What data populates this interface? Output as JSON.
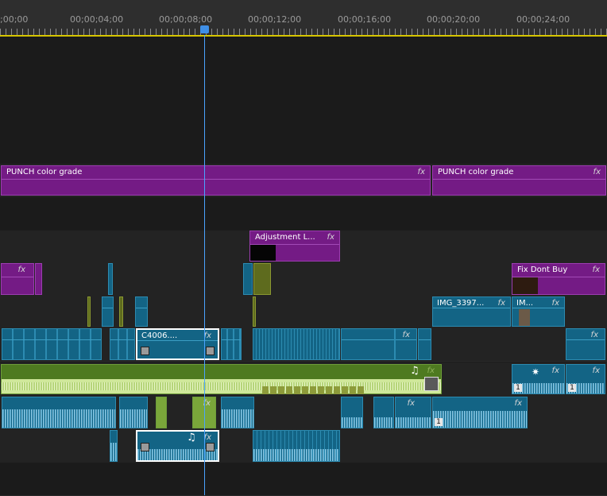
{
  "ruler": {
    "timecodes": [
      ";00;00",
      "00;00;04;00",
      "00;00;08;00",
      "00;00;12;00",
      "00;00;16;00",
      "00;00;20;00",
      "00;00;24;00"
    ]
  },
  "tracks": {
    "punch": {
      "clip1_title": "PUNCH color grade",
      "clip2_title": "PUNCH color grade"
    },
    "adjustment": {
      "clip_title": "Adjustment L..."
    },
    "v4": {
      "clip_title": "Fix Dont Buy"
    },
    "v3": {
      "clip1_title": "IMG_3397...",
      "clip2_title": "IM..."
    },
    "v2": {
      "clip_title": "C4006...."
    },
    "badges": {
      "a": "1",
      "b": "1",
      "c": "1"
    }
  },
  "icons": {
    "fx": "fx",
    "music": "♫",
    "sparkle": "✷"
  }
}
